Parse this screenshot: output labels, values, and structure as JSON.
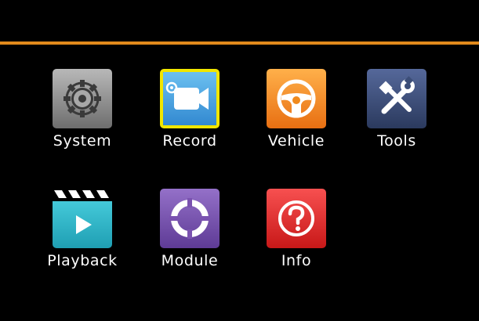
{
  "theme": {
    "background": "#000000",
    "accent_rule": "#e28a1c",
    "selection": "#f1e600",
    "label_color": "#ffffff"
  },
  "menu": {
    "items": [
      {
        "label": "System",
        "icon": "gear-icon",
        "tile_color": "#8a8a8a",
        "selected": false
      },
      {
        "label": "Record",
        "icon": "video-camera-icon",
        "tile_color": "#4aa6e0",
        "selected": true
      },
      {
        "label": "Vehicle",
        "icon": "steering-wheel-icon",
        "tile_color": "#f08a1e",
        "selected": false
      },
      {
        "label": "Tools",
        "icon": "wrench-screwdriver-icon",
        "tile_color": "#3c4e78",
        "selected": false
      },
      {
        "label": "Playback",
        "icon": "clapperboard-play-icon",
        "tile_color": "#2fb6c8",
        "selected": false
      },
      {
        "label": "Module",
        "icon": "lifebuoy-icon",
        "tile_color": "#7a52b0",
        "selected": false
      },
      {
        "label": "Info",
        "icon": "question-mark-icon",
        "tile_color": "#e52a2a",
        "selected": false
      }
    ]
  }
}
